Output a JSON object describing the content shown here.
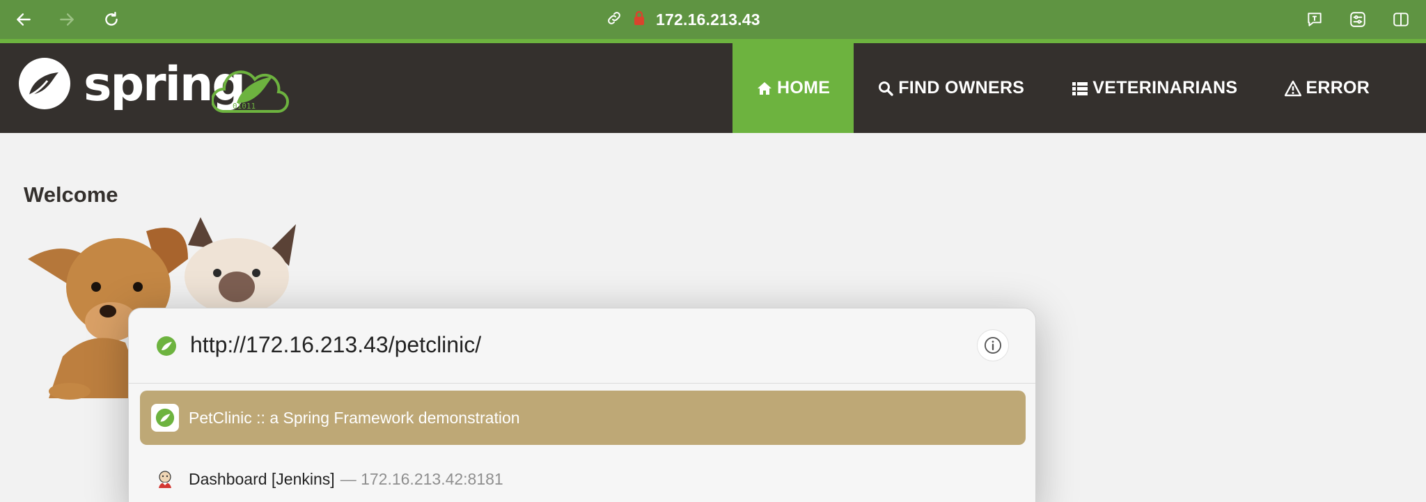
{
  "browser": {
    "url_display": "172.16.213.43",
    "back_icon": "back-arrow-icon",
    "forward_icon": "forward-arrow-icon",
    "reload_icon": "reload-icon",
    "colors": {
      "toolbar": "#5f9442",
      "accent_line": "#6db33f"
    }
  },
  "site": {
    "logo_text": "spring",
    "nav": [
      {
        "label": "HOME",
        "icon": "home-icon",
        "active": true
      },
      {
        "label": "FIND OWNERS",
        "icon": "search-icon",
        "active": false
      },
      {
        "label": "VETERINARIANS",
        "icon": "list-icon",
        "active": false
      },
      {
        "label": "ERROR",
        "icon": "warning-icon",
        "active": false
      }
    ],
    "colors": {
      "navbar": "#34302d",
      "active": "#6db33f"
    }
  },
  "main": {
    "heading": "Welcome"
  },
  "autocomplete": {
    "typed_url": "http://172.16.213.43/petclinic/",
    "suggestions": [
      {
        "title": "PetClinic :: a Spring Framework demonstration",
        "subtitle": "",
        "icon": "spring-favicon-icon",
        "selected": true
      },
      {
        "title": "Dashboard [Jenkins]",
        "subtitle": "— 172.16.213.42:8181",
        "icon": "jenkins-favicon-icon",
        "selected": false
      }
    ],
    "colors": {
      "selected": "#bea876"
    }
  }
}
